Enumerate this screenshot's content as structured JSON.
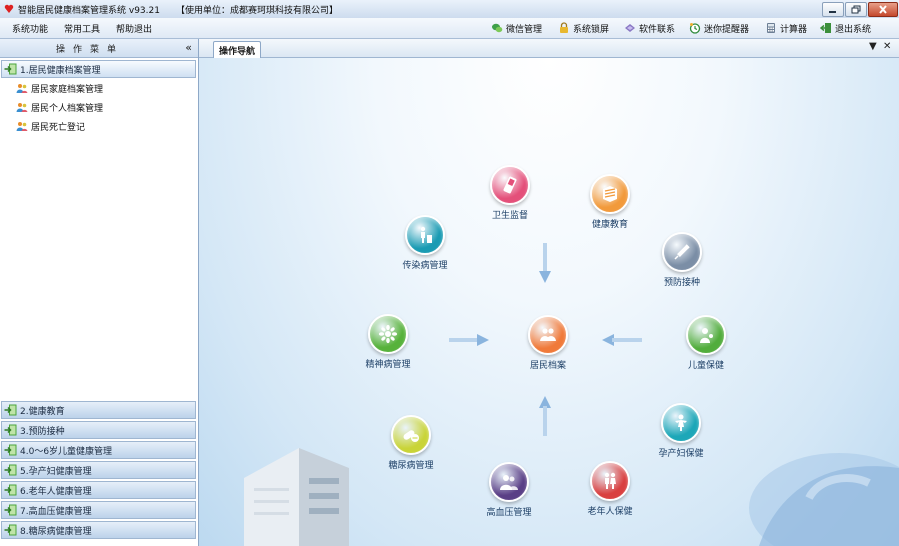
{
  "window": {
    "title": "智能居民健康档案管理系统 v93.21",
    "unit": "【使用单位：成都赛珂琪科技有限公司】"
  },
  "menu": [
    "系统功能",
    "常用工具",
    "帮助退出"
  ],
  "toolbar": [
    {
      "label": "微信管理",
      "icon": "wechat-icon"
    },
    {
      "label": "系统锁屏",
      "icon": "lock-icon"
    },
    {
      "label": "软件联系",
      "icon": "contact-icon"
    },
    {
      "label": "迷你提醒器",
      "icon": "reminder-icon"
    },
    {
      "label": "计算器",
      "icon": "calculator-icon"
    },
    {
      "label": "退出系统",
      "icon": "exit-icon"
    }
  ],
  "sidebar": {
    "header": "操作菜单",
    "collapse_glyph": "«",
    "active_group": "1.居民健康档案管理",
    "subitems": [
      "居民家庭档案管理",
      "居民个人档案管理",
      "居民死亡登记"
    ],
    "groups": [
      "2.健康教育",
      "3.预防接种",
      "4.0～6岁儿童健康管理",
      "5.孕产妇健康管理",
      "6.老年人健康管理",
      "7.高血压健康管理",
      "8.糖尿病健康管理"
    ]
  },
  "tabs": {
    "active": "操作导航",
    "dropdown_glyph": "▼",
    "close_glyph": "✕"
  },
  "nav": {
    "center": {
      "label": "居民档案",
      "color": "#f07a3a",
      "icon": "family-icon"
    },
    "health_supervision": {
      "label": "卫生监督",
      "color": "#e4507a",
      "icon": "phone-icon"
    },
    "health_education": {
      "label": "健康教育",
      "color": "#f29a3b",
      "icon": "book-icon"
    },
    "infectious": {
      "label": "传染病管理",
      "color": "#1a9bb3",
      "icon": "trash-person-icon"
    },
    "vaccination": {
      "label": "预防接种",
      "color": "#7b8ea6",
      "icon": "syringe-icon"
    },
    "mental": {
      "label": "精神病管理",
      "color": "#57b23b",
      "icon": "flower-icon"
    },
    "child": {
      "label": "儿童保健",
      "color": "#52ad3c",
      "icon": "baby-icon"
    },
    "diabetes": {
      "label": "糖尿病管理",
      "color": "#c9d438",
      "icon": "pills-icon"
    },
    "maternal": {
      "label": "孕产妇保健",
      "color": "#1da7b8",
      "icon": "pregnant-icon"
    },
    "hypertension": {
      "label": "高血压管理",
      "color": "#5a3f86",
      "icon": "people-icon"
    },
    "elderly": {
      "label": "老年人保健",
      "color": "#d94040",
      "icon": "elderly-icon"
    }
  }
}
